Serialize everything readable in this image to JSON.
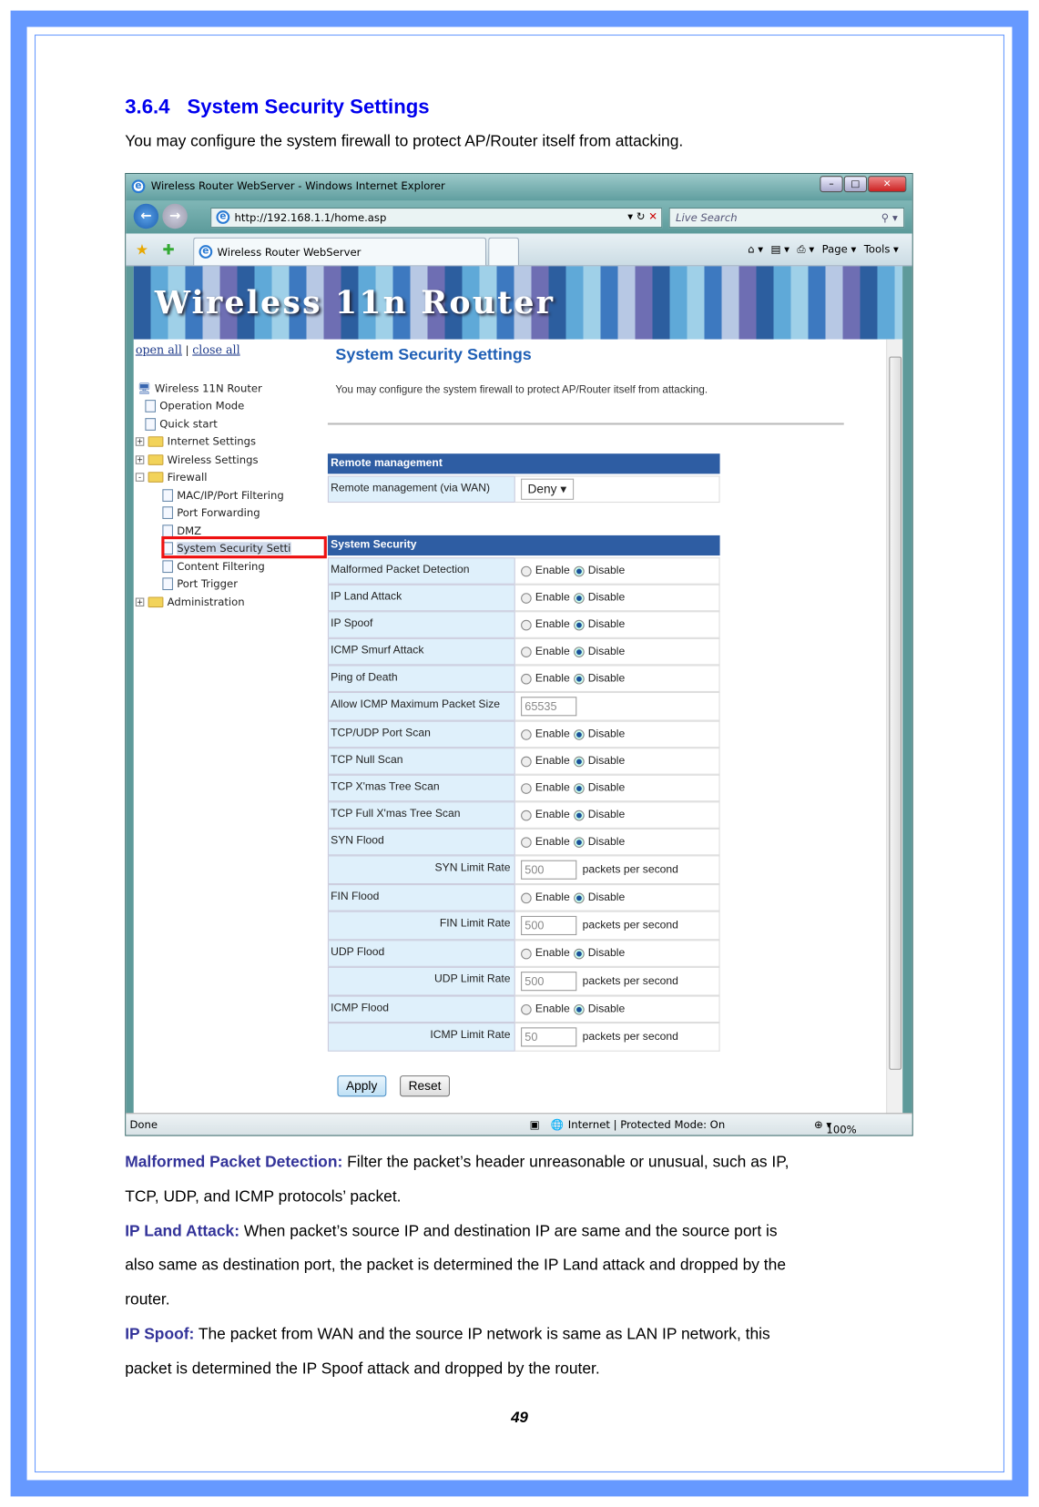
{
  "section": {
    "number": "3.6.4",
    "title": "System Security Settings",
    "intro": "You may configure the system firewall to protect AP/Router itself from attacking."
  },
  "browser": {
    "window_title": "Wireless Router WebServer - Windows Internet Explorer",
    "url": "http://192.168.1.1/home.asp",
    "search_placeholder": "Live Search",
    "tab_label": "Wireless Router WebServer",
    "toolbar": {
      "page": "Page ▾",
      "tools": "Tools ▾"
    },
    "banner": "Wireless 11n Router",
    "status": {
      "left": "Done",
      "zone": "Internet | Protected Mode: On",
      "zoom": "100%"
    }
  },
  "tree": {
    "open_all": "open all",
    "separator": "|",
    "close_all": "close all",
    "items": [
      {
        "label": "Wireless 11N Router",
        "type": "root"
      },
      {
        "label": "Operation Mode",
        "type": "file"
      },
      {
        "label": "Quick start",
        "type": "file"
      },
      {
        "label": "Internet Settings",
        "type": "folder",
        "toggle": "+"
      },
      {
        "label": "Wireless Settings",
        "type": "folder",
        "toggle": "+"
      },
      {
        "label": "Firewall",
        "type": "folder",
        "toggle": "-"
      },
      {
        "label": "MAC/IP/Port Filtering",
        "type": "file",
        "child": true
      },
      {
        "label": "Port Forwarding",
        "type": "file",
        "child": true
      },
      {
        "label": "DMZ",
        "type": "file",
        "child": true
      },
      {
        "label": "System Security Setti",
        "type": "file",
        "child": true,
        "selected": true
      },
      {
        "label": "Content Filtering",
        "type": "file",
        "child": true
      },
      {
        "label": "Port Trigger",
        "type": "file",
        "child": true
      },
      {
        "label": "Administration",
        "type": "folder",
        "toggle": "+"
      }
    ]
  },
  "page": {
    "title": "System Security Settings",
    "desc": "You may configure the system firewall to protect AP/Router itself from attacking.",
    "remote": {
      "header": "Remote management",
      "label": "Remote management (via WAN)",
      "value": "Deny"
    },
    "security": {
      "header": "System Security",
      "enable": "Enable",
      "disable": "Disable",
      "unit": "packets per second",
      "rows": [
        {
          "label": "Malformed Packet Detection",
          "kind": "radio",
          "value": "Disable"
        },
        {
          "label": "IP Land Attack",
          "kind": "radio",
          "value": "Disable"
        },
        {
          "label": "IP Spoof",
          "kind": "radio",
          "value": "Disable"
        },
        {
          "label": "ICMP Smurf Attack",
          "kind": "radio",
          "value": "Disable"
        },
        {
          "label": "Ping of Death",
          "kind": "radio",
          "value": "Disable"
        },
        {
          "label": "Allow ICMP Maximum Packet Size",
          "kind": "input",
          "value": "65535"
        },
        {
          "label": "TCP/UDP Port Scan",
          "kind": "radio",
          "value": "Disable"
        },
        {
          "label": "TCP Null Scan",
          "kind": "radio",
          "value": "Disable"
        },
        {
          "label": "TCP X'mas Tree Scan",
          "kind": "radio",
          "value": "Disable"
        },
        {
          "label": "TCP Full X'mas Tree Scan",
          "kind": "radio",
          "value": "Disable"
        },
        {
          "label": "SYN Flood",
          "kind": "radio",
          "value": "Disable"
        },
        {
          "label": "SYN Limit Rate",
          "kind": "rate",
          "value": "500"
        },
        {
          "label": "FIN Flood",
          "kind": "radio",
          "value": "Disable"
        },
        {
          "label": "FIN Limit Rate",
          "kind": "rate",
          "value": "500"
        },
        {
          "label": "UDP Flood",
          "kind": "radio",
          "value": "Disable"
        },
        {
          "label": "UDP Limit Rate",
          "kind": "rate",
          "value": "500"
        },
        {
          "label": "ICMP Flood",
          "kind": "radio",
          "value": "Disable"
        },
        {
          "label": "ICMP Limit Rate",
          "kind": "rate",
          "value": "50"
        }
      ]
    },
    "apply": "Apply",
    "reset": "Reset"
  },
  "descriptions": [
    {
      "term": "Malformed Packet Detection:",
      "lines": [
        " Filter the packet’s header unreasonable or unusual, such as IP,",
        "TCP, UDP, and ICMP protocols’ packet."
      ]
    },
    {
      "term": "IP Land Attack:",
      "lines": [
        " When packet’s source IP and destination IP are same and the source port is",
        "also same as destination port, the packet is determined the IP Land attack and dropped by the",
        "router."
      ]
    },
    {
      "term": "IP Spoof:",
      "lines": [
        " The packet from WAN and the source IP network is same as LAN IP network, this",
        "packet is determined the IP Spoof attack and dropped by the router."
      ]
    }
  ],
  "page_number": "49",
  "colors": {
    "border": "#6699ff",
    "heading": "#0000ee",
    "term": "#333399",
    "table_header": "#2e5da3",
    "highlight": "#ee1111"
  }
}
